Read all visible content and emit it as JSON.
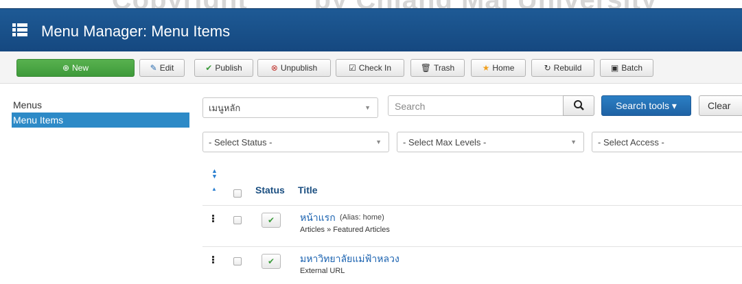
{
  "watermark": "Copyright        by Chiang Mai University",
  "header": {
    "title": "Menu Manager: Menu Items",
    "icon": "list-icon"
  },
  "toolbar": {
    "new": "New",
    "edit": "Edit",
    "publish": "Publish",
    "unpublish": "Unpublish",
    "checkin": "Check In",
    "trash": "Trash",
    "home": "Home",
    "rebuild": "Rebuild",
    "batch": "Batch"
  },
  "sidebar": {
    "items": [
      {
        "label": "Menus"
      },
      {
        "label": "Menu Items",
        "active": true
      }
    ]
  },
  "filters": {
    "menu_select": "เมนูหลัก",
    "search_placeholder": "Search",
    "search_tools": "Search tools ▾",
    "clear": "Clear",
    "status": "- Select Status -",
    "max_levels": "- Select Max Levels -",
    "access": "- Select Access -"
  },
  "table": {
    "headers": {
      "status": "Status",
      "title": "Title"
    },
    "rows": [
      {
        "title": "หน้าแรก",
        "alias": "(Alias: home)",
        "type": "Articles » Featured Articles",
        "published": true
      },
      {
        "title": "มหาวิทยาลัยแม่ฟ้าหลวง",
        "type": "External URL",
        "published": true
      }
    ]
  },
  "colors": {
    "header": "#1e5a95",
    "accent": "#2d8ac7",
    "new_button": "#4ca845"
  }
}
